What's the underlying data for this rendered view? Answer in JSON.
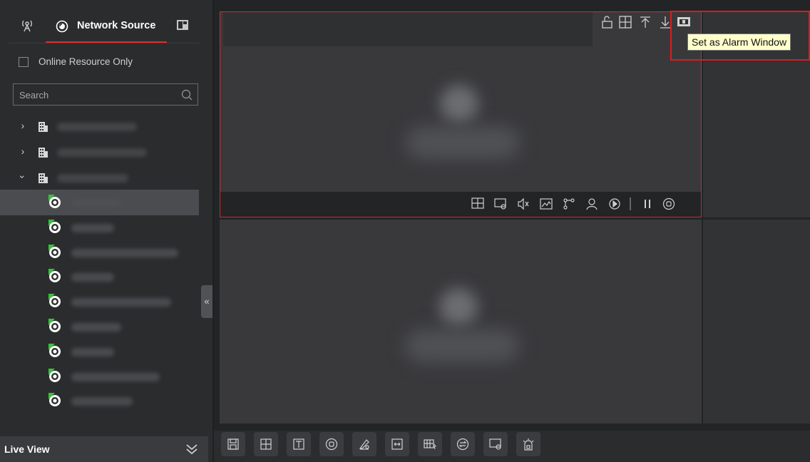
{
  "sidebar": {
    "tabs": [
      {
        "name": "device-tab",
        "icon": "antenna-icon"
      },
      {
        "name": "network-source-tab",
        "label": "Network Source",
        "icon": "network-icon"
      },
      {
        "name": "layout-tab",
        "icon": "layout-icon"
      }
    ],
    "online_only_label": "Online Resource Only",
    "online_only_checked": false,
    "search": {
      "placeholder": "Search",
      "value": ""
    },
    "tree": {
      "groups": [
        {
          "expanded": false,
          "icon": "building-icon"
        },
        {
          "expanded": false,
          "icon": "building-icon"
        },
        {
          "expanded": true,
          "icon": "building-icon"
        }
      ],
      "cameras": [
        {
          "selected": true,
          "icon": "camera-online-icon"
        },
        {
          "selected": false,
          "icon": "camera-online-icon"
        },
        {
          "selected": false,
          "icon": "camera-online-icon"
        },
        {
          "selected": false,
          "icon": "camera-online-icon"
        },
        {
          "selected": false,
          "icon": "camera-online-icon"
        },
        {
          "selected": false,
          "icon": "camera-online-icon"
        },
        {
          "selected": false,
          "icon": "camera-online-icon"
        },
        {
          "selected": false,
          "icon": "camera-online-icon"
        },
        {
          "selected": false,
          "icon": "camera-online-icon"
        }
      ]
    },
    "collapse_glyph": "«",
    "footer_label": "Live View"
  },
  "tooltip": "Set as Alarm Window",
  "colors": {
    "accent": "#e02b2b",
    "online": "#38c23a",
    "selection": "#4b4c4f"
  }
}
